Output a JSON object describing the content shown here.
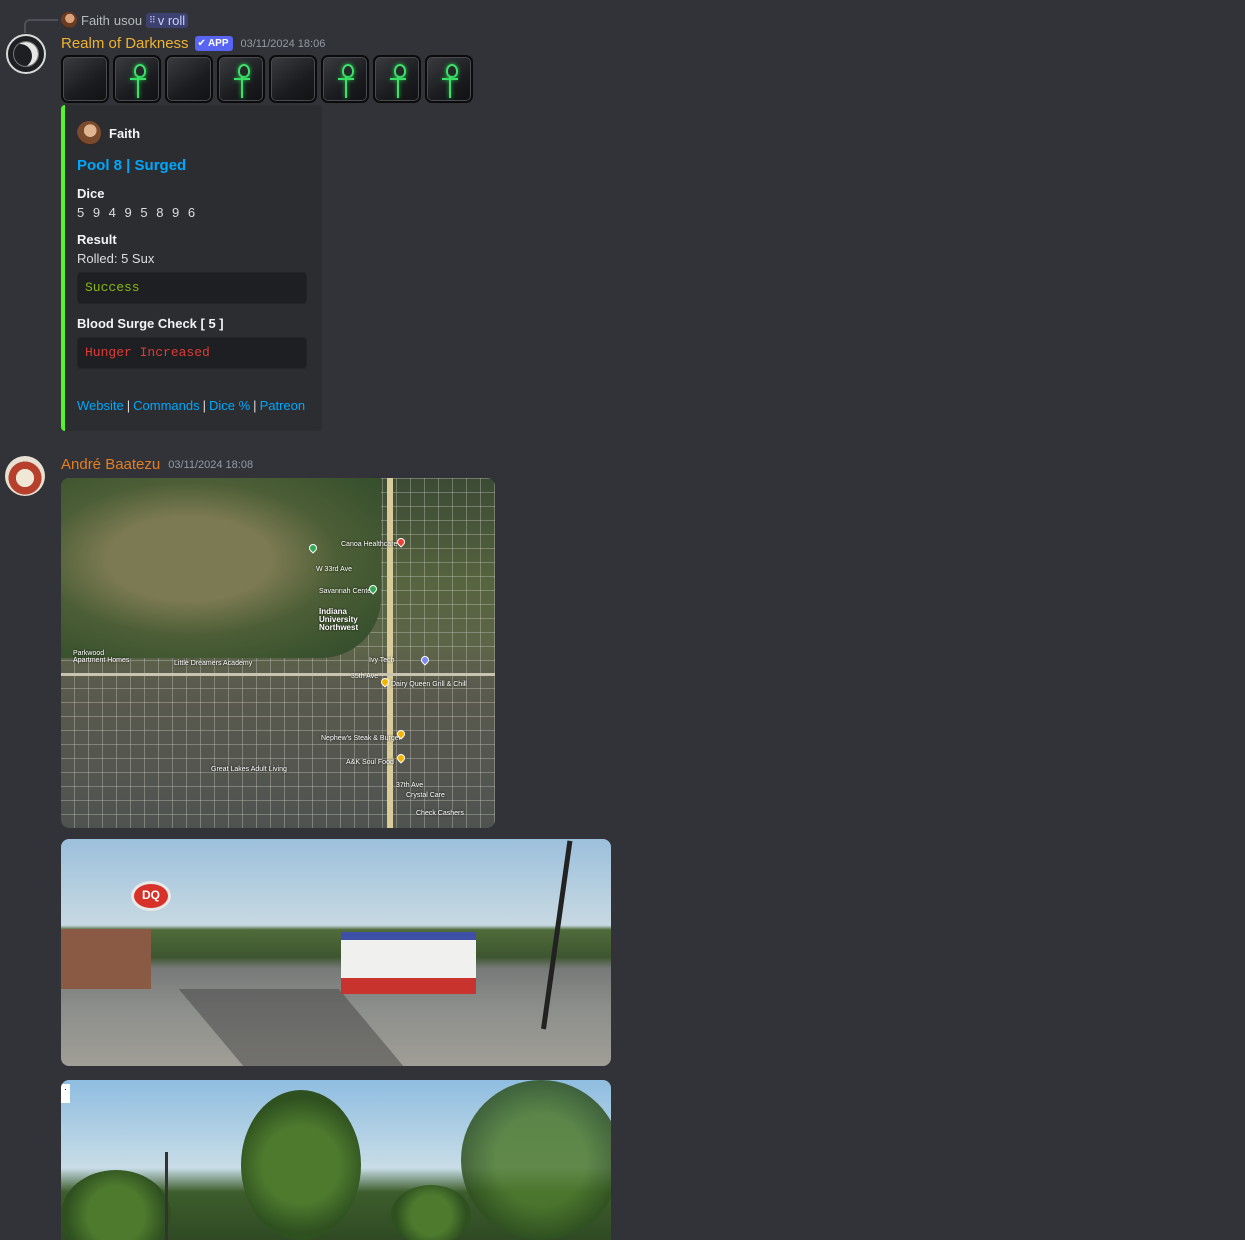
{
  "reply": {
    "user_name": "Faith",
    "action": "usou",
    "command": "v roll"
  },
  "bot_message": {
    "author": "Realm of Darkness",
    "app_tag": "APP",
    "timestamp": "03/11/2024 18:06",
    "dice": [
      "blank",
      "ankh",
      "blank",
      "ankh",
      "blank",
      "ankh",
      "ankh",
      "ankh"
    ],
    "embed": {
      "accent_color": "#57f22a",
      "author_name": "Faith",
      "title": "Pool 8 | Surged",
      "fields": {
        "dice_label": "Dice",
        "dice_value": "5 9 4 9 5 8 9 6",
        "result_label": "Result",
        "result_value": "Rolled: 5 Sux",
        "result_code": "Success",
        "surge_label": "Blood Surge Check [ 5 ]",
        "surge_code": "Hunger Increased"
      },
      "links": {
        "website": "Website",
        "commands": "Commands",
        "dice_pct": "Dice %",
        "patreon": "Patreon",
        "separator": "|"
      }
    }
  },
  "user_message": {
    "author": "André Baatezu",
    "timestamp": "03/11/2024 18:08",
    "map_labels": {
      "university": "Indiana University Northwest",
      "ave_33": "W 33rd Ave",
      "ave_35": "35th Ave",
      "ave_37": "37th Ave",
      "ivy_tech": "Ivy Tech",
      "dq": "Dairy Queen Grill & Chill",
      "nephews": "Nephew's Steak & Burger",
      "soul_food": "A&K Soul Food",
      "great_lakes": "Great Lakes Adult Living",
      "dreamers": "Little Dreamers Academy",
      "parkwood": "Parkwood Apartment Homes",
      "crystal_care": "Crystal Care",
      "canoa": "Canoa Healthcare",
      "savannah": "Savannah Center",
      "check_cashers": "Check Cashers"
    },
    "sign_text": "DQ",
    "photo2_badge": "·"
  }
}
